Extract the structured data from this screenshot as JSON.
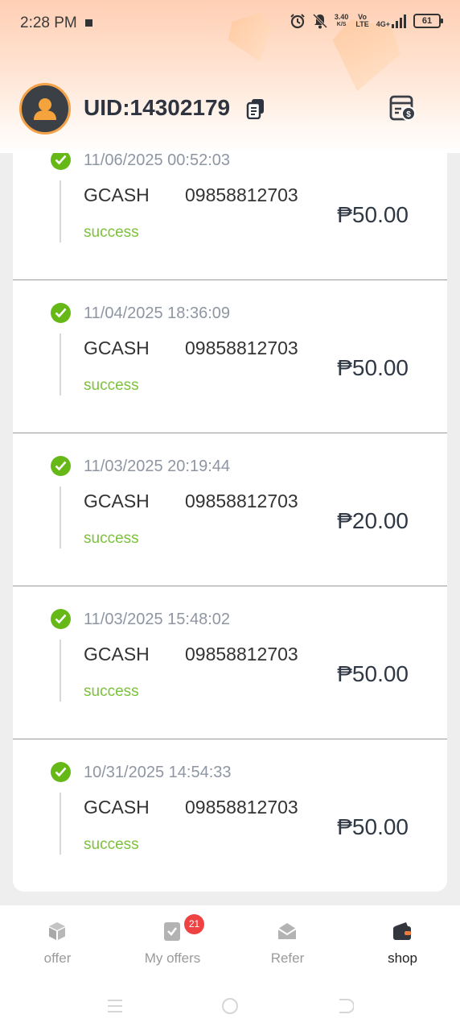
{
  "status_bar": {
    "time": "2:28 PM",
    "net_speed_value": "3.40",
    "net_speed_unit": "K/S",
    "volte_top": "Vo",
    "volte_bottom": "LTE",
    "network_type": "4G+",
    "battery": "61"
  },
  "header": {
    "uid": "UID:14302179",
    "accent_color": "#f4a24a"
  },
  "records": [
    {
      "datetime": "11/06/2025 00:52:03",
      "method": "GCASH",
      "account": "09858812703",
      "status": "success",
      "amount": "₱50.00"
    },
    {
      "datetime": "11/04/2025 18:36:09",
      "method": "GCASH",
      "account": "09858812703",
      "status": "success",
      "amount": "₱50.00"
    },
    {
      "datetime": "11/03/2025 20:19:44",
      "method": "GCASH",
      "account": "09858812703",
      "status": "success",
      "amount": "₱20.00"
    },
    {
      "datetime": "11/03/2025 15:48:02",
      "method": "GCASH",
      "account": "09858812703",
      "status": "success",
      "amount": "₱50.00"
    },
    {
      "datetime": "10/31/2025 14:54:33",
      "method": "GCASH",
      "account": "09858812703",
      "status": "success",
      "amount": "₱50.00"
    }
  ],
  "bottom_nav": {
    "items": [
      {
        "label": "offer",
        "icon": "cube-icon"
      },
      {
        "label": "My offers",
        "icon": "clipboard-check-icon",
        "badge": "21"
      },
      {
        "label": "Refer",
        "icon": "envelope-icon"
      },
      {
        "label": "shop",
        "icon": "wallet-icon",
        "active": true
      }
    ]
  },
  "colors": {
    "success": "#7cc23a",
    "check": "#66b817",
    "badge": "#ef4343"
  }
}
